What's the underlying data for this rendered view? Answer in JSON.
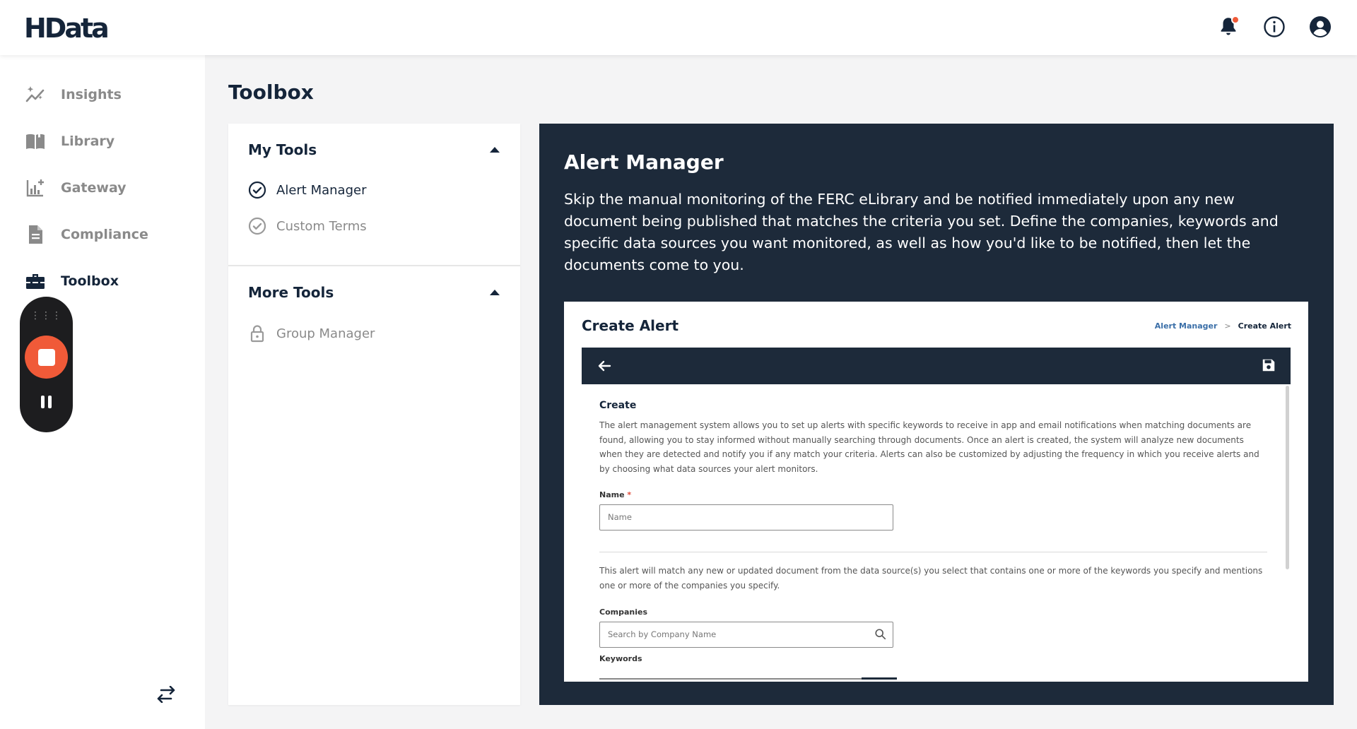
{
  "app": {
    "logo": "HData"
  },
  "topbar": {
    "icons": [
      "bell-icon",
      "info-icon",
      "account-icon"
    ],
    "accent": "#f05a38"
  },
  "sidebar": {
    "items": [
      {
        "label": "Insights",
        "icon": "sparkle-chart-icon"
      },
      {
        "label": "Library",
        "icon": "book-icon"
      },
      {
        "label": "Gateway",
        "icon": "chart-add-icon"
      },
      {
        "label": "Compliance",
        "icon": "document-icon"
      },
      {
        "label": "Toolbox",
        "icon": "toolbox-icon",
        "active": true
      }
    ]
  },
  "recorder": {
    "handle": "⋮⋮⋮",
    "stop": "stop-icon",
    "pause": "pause-icon"
  },
  "page": {
    "title": "Toolbox"
  },
  "tools": {
    "my_tools": {
      "heading": "My Tools",
      "items": [
        {
          "label": "Alert Manager",
          "status": "check-circle-icon"
        },
        {
          "label": "Custom Terms",
          "status": "check-circle-icon"
        }
      ]
    },
    "more_tools": {
      "heading": "More Tools",
      "items": [
        {
          "label": "Group Manager",
          "status": "lock-icon"
        }
      ]
    }
  },
  "alert": {
    "title": "Alert Manager",
    "description": "Skip the manual monitoring of the FERC eLibrary and be notified immediately upon any new document being published that matches the criteria you set. Define the companies, keywords and specific data sources you want monitored, as well as how you'd like to be notified, then let the documents come to you.",
    "preview": {
      "title": "Create Alert",
      "breadcrumb": {
        "link": "Alert Manager",
        "separator": ">",
        "current": "Create Alert"
      },
      "section_heading": "Create",
      "intro": "The alert management system allows you to set up alerts with specific keywords to receive in app and email notifications when matching documents are found, allowing you to stay informed without manually searching through documents. Once an alert is created, the system will analyze new documents when they are detected and notify you if any match your criteria. Alerts can also be customized by adjusting the frequency in which you receive alerts and by choosing what data sources your alert monitors.",
      "name_label": "Name",
      "name_required": "*",
      "name_placeholder": "Name",
      "match_text": "This alert will match any new or updated document from the data source(s) you select that contains one or more of the keywords you specify and mentions one or more of the companies you specify.",
      "companies_label": "Companies",
      "companies_placeholder": "Search by Company Name",
      "keywords_label": "Keywords"
    }
  }
}
